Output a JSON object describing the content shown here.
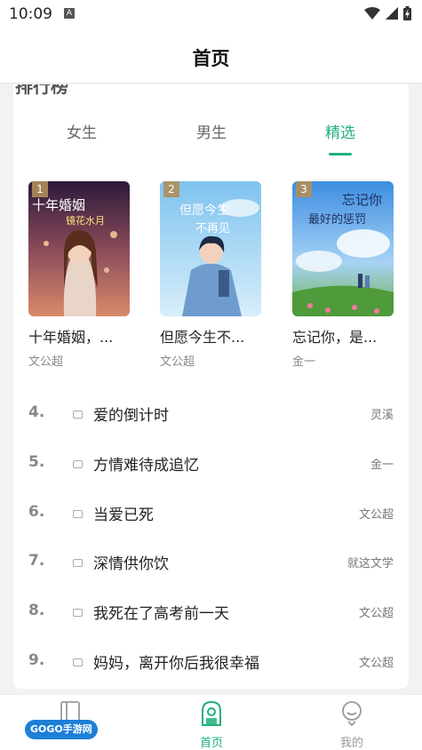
{
  "status_bar": {
    "time": "10:09",
    "notification_letter": "A"
  },
  "header": {
    "title": "首页"
  },
  "section": {
    "clipped_title": "排行榜"
  },
  "tabs": [
    {
      "label": "女生",
      "active": false
    },
    {
      "label": "男生",
      "active": false
    },
    {
      "label": "精选",
      "active": true
    }
  ],
  "top_books": [
    {
      "rank": "1",
      "title": "十年婚姻，...",
      "author": "文公超",
      "cover_text": "十年婚姻",
      "cover_subtext": "镜花水月"
    },
    {
      "rank": "2",
      "title": "但愿今生不...",
      "author": "文公超",
      "cover_text": "但愿今生",
      "cover_subtext": "不再见"
    },
    {
      "rank": "3",
      "title": "忘记你，是...",
      "author": "金一",
      "cover_text": "忘记你",
      "cover_subtext": "最好的惩罚"
    }
  ],
  "ranking": [
    {
      "num": "4.",
      "title": "爱的倒计时",
      "author": "灵溪"
    },
    {
      "num": "5.",
      "title": "方情难待成追忆",
      "author": "金一"
    },
    {
      "num": "6.",
      "title": "当爱已死",
      "author": "文公超"
    },
    {
      "num": "7.",
      "title": "深情供你饮",
      "author": "就这文学"
    },
    {
      "num": "8.",
      "title": "我死在了高考前一天",
      "author": "文公超"
    },
    {
      "num": "9.",
      "title": "妈妈，离开你后我很幸福",
      "author": "文公超"
    }
  ],
  "bottom_nav": [
    {
      "label": "",
      "icon": "bookshelf-icon",
      "active": false
    },
    {
      "label": "首页",
      "icon": "home-icon",
      "active": true
    },
    {
      "label": "我的",
      "icon": "profile-icon",
      "active": false
    }
  ],
  "watermark": {
    "text": "GOGO手游网"
  },
  "colors": {
    "accent": "#20b07a",
    "background": "#f2f2f2"
  }
}
